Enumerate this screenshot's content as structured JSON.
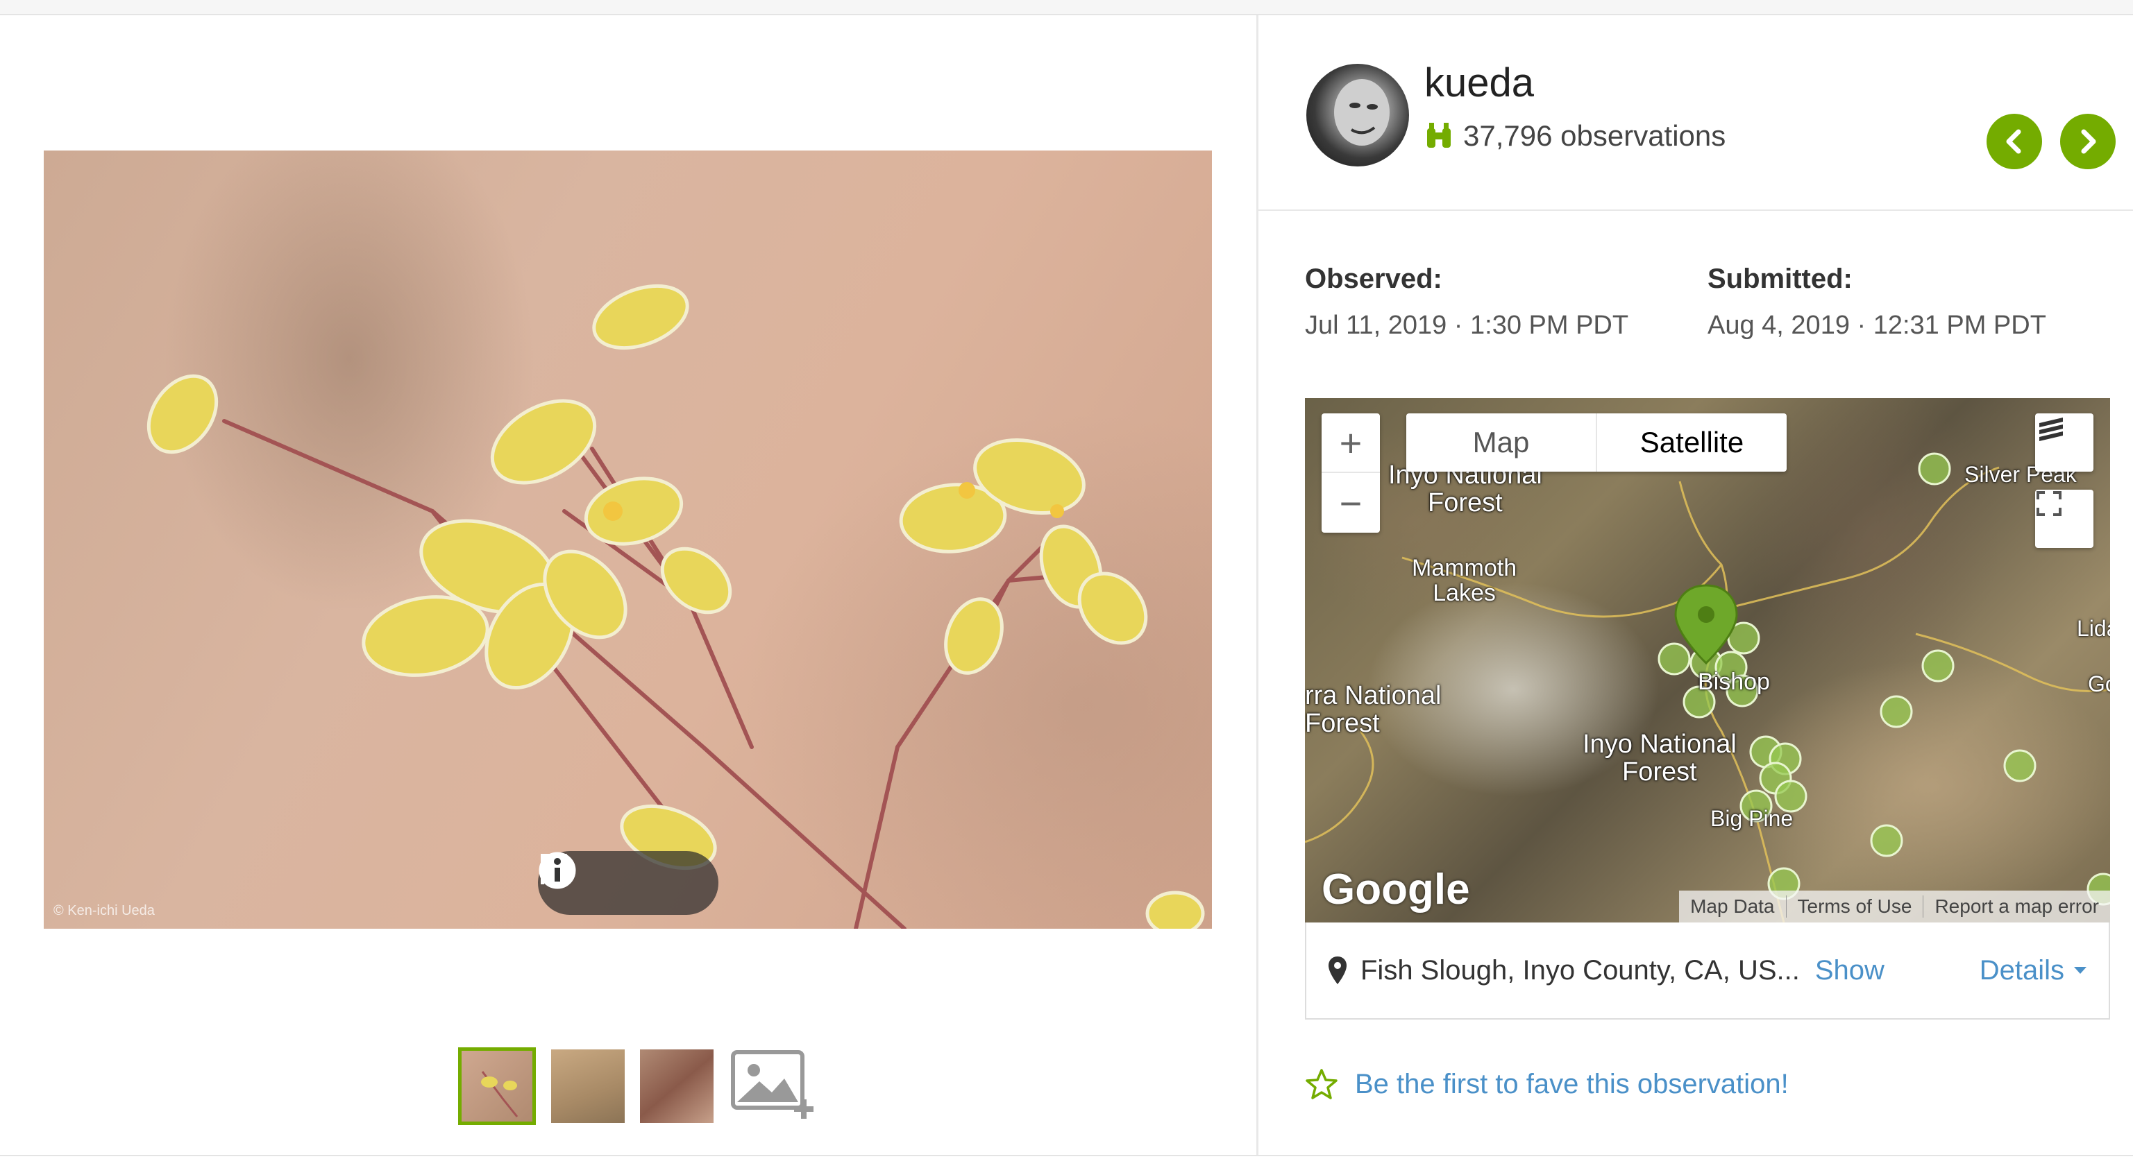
{
  "photo": {
    "credit": "© Ken-ichi Ueda"
  },
  "user": {
    "name": "kueda",
    "observations": "37,796 observations"
  },
  "meta": {
    "observed_label": "Observed:",
    "observed_value": "Jul 11, 2019 · 1:30 PM PDT",
    "submitted_label": "Submitted:",
    "submitted_value": "Aug 4, 2019 · 12:31 PM PDT"
  },
  "map": {
    "zoom_in": "+",
    "zoom_out": "−",
    "type_map": "Map",
    "type_satellite": "Satellite",
    "labels": {
      "inyo_nf_top": "Inyo National\nForest",
      "mammoth": "Mammoth\nLakes",
      "sierra_nf": "rra National\nForest",
      "bishop": "Bishop",
      "inyo_nf_mid": "Inyo National\nForest",
      "big_pine": "Big Pine",
      "silver_peak": "Silver Peak",
      "lida": "Lida",
      "go": "Go"
    },
    "google": "Google",
    "attribution": [
      "Map Data",
      "Terms of Use",
      "Report a map error"
    ]
  },
  "location": {
    "text": "Fish Slough, Inyo County, CA, US...",
    "show": "Show",
    "details": "Details"
  },
  "fave": {
    "text": "Be the first to fave this observation!"
  },
  "colors": {
    "accent": "#74ac00",
    "link": "#4a90c8"
  }
}
